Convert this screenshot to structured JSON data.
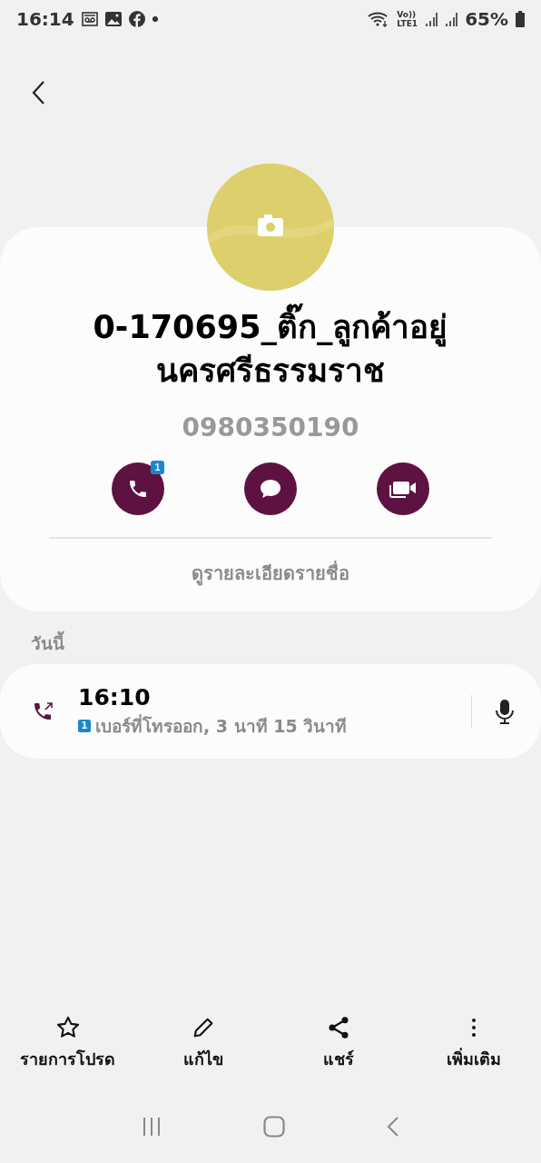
{
  "status_bar": {
    "time": "16:14",
    "network_top": "Vo))",
    "network_bottom": "LTE1",
    "battery": "65%"
  },
  "contact": {
    "name": "0-170695_ติ๊ก_ลูกค้าอยู่นครศรีธรรมราช",
    "number": "0980350190",
    "details_link": "ดูรายละเอียดรายชื่อ",
    "actions": [
      {
        "kind": "call",
        "badge": "1"
      },
      {
        "kind": "message"
      },
      {
        "kind": "video"
      }
    ]
  },
  "history": {
    "heading": "วันนี้",
    "entries": [
      {
        "time": "16:10",
        "sim": "1",
        "detail": "เบอร์ที่โทรออก, 3 นาที 15 วินาที"
      }
    ]
  },
  "bottom_bar": [
    {
      "kind": "star",
      "label": "รายการโปรด"
    },
    {
      "kind": "edit",
      "label": "แก้ไข"
    },
    {
      "kind": "share",
      "label": "แชร์"
    },
    {
      "kind": "more",
      "label": "เพิ่มเติม"
    }
  ]
}
